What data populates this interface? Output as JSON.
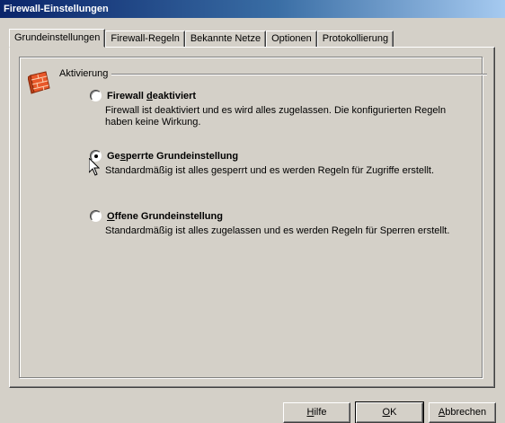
{
  "window": {
    "title": "Firewall-Einstellungen"
  },
  "tabs": [
    {
      "label": "Grundeinstellungen",
      "active": true
    },
    {
      "label": "Firewall-Regeln",
      "active": false
    },
    {
      "label": "Bekannte Netze",
      "active": false
    },
    {
      "label": "Optionen",
      "active": false
    },
    {
      "label": "Protokollierung",
      "active": false
    }
  ],
  "section": {
    "label": "Aktivierung",
    "icon": "firewall-wall-icon"
  },
  "options": [
    {
      "title_before": "Firewall ",
      "title_u": "d",
      "title_after": "eaktiviert",
      "description": "Firewall ist deaktiviert und es wird alles zugelassen. Die konfigurierten Regeln haben keine Wirkung.",
      "selected": false
    },
    {
      "title_before": "Ge",
      "title_u": "s",
      "title_after": "perrte Grundeinstellung",
      "description": "Standardmäßig ist alles gesperrt und es werden Regeln für Zugriffe erstellt.",
      "selected": true
    },
    {
      "title_before": "",
      "title_u": "O",
      "title_after": "ffene Grundeinstellung",
      "description": "Standardmäßig ist alles zugelassen und es werden Regeln für Sperren erstellt.",
      "selected": false
    }
  ],
  "buttons": {
    "help": {
      "before": "",
      "u": "H",
      "after": "ilfe"
    },
    "ok": {
      "before": "",
      "u": "O",
      "after": "K"
    },
    "cancel": {
      "before": "",
      "u": "A",
      "after": "bbrechen"
    }
  },
  "colors": {
    "titlebar_start": "#0a246a",
    "titlebar_end": "#a6caf0",
    "face": "#d4d0c8",
    "wall": "#e8582a"
  }
}
